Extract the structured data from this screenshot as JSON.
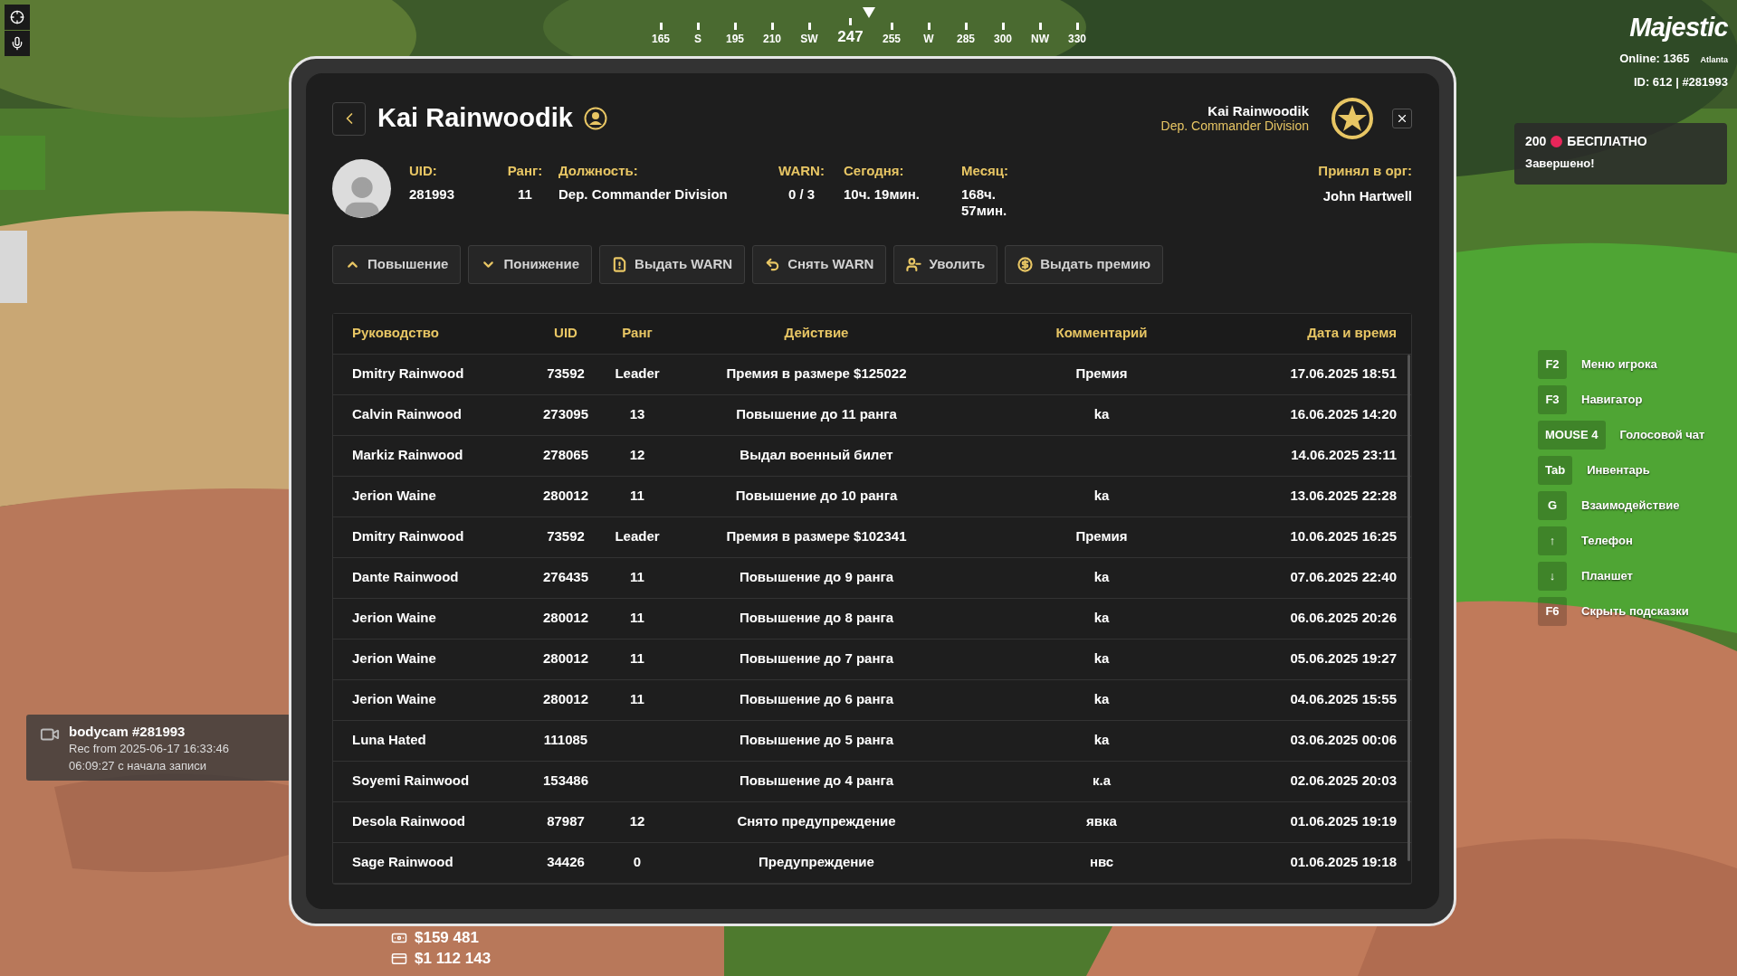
{
  "compass": {
    "heading": "247",
    "marks": [
      "165",
      "S",
      "195",
      "210",
      "SW",
      "255",
      "W",
      "285",
      "300",
      "NW",
      "330"
    ]
  },
  "hud": {
    "logo": "Majestic",
    "online": "Online: 1365",
    "server": "Atlanta",
    "id": "ID: 612 | #281993"
  },
  "promo": {
    "amount": "200",
    "label": "БЕСПЛАТНО",
    "status": "Завершено!"
  },
  "hints": [
    {
      "key": "F2",
      "label": "Меню игрока"
    },
    {
      "key": "F3",
      "label": "Навигатор"
    },
    {
      "key": "MOUSE 4",
      "label": "Голосовой чат"
    },
    {
      "key": "Tab",
      "label": "Инвентарь"
    },
    {
      "key": "G",
      "label": "Взаимодействие"
    },
    {
      "key": "↑",
      "label": "Телефон"
    },
    {
      "key": "↓",
      "label": "Планшет"
    },
    {
      "key": "F6",
      "label": "Скрыть подсказки"
    }
  ],
  "bodycam": {
    "title": "bodycam #281993",
    "rec": "Rec from 2025-06-17 16:33:46",
    "elapsed": "06:09:27 с начала записи"
  },
  "money": {
    "cash": "$159 481",
    "bank": "$1 112 143"
  },
  "profile": {
    "title": "Kai Rainwoodik",
    "viewer_name": "Kai Rainwoodik",
    "viewer_division": "Dep. Commander Division",
    "fields": [
      {
        "label": "UID:",
        "value": "281993"
      },
      {
        "label": "Ранг:",
        "value": "11"
      },
      {
        "label": "Должность:",
        "value": "Dep. Commander Division"
      },
      {
        "label": "WARN:",
        "value": "0 / 3"
      },
      {
        "label": "Сегодня:",
        "value": "10ч. 19мин."
      },
      {
        "label": "Месяц:",
        "value": "168ч. 57мин."
      }
    ],
    "accepted_by": {
      "label": "Принял в орг:",
      "value": "John Hartwell"
    },
    "actions": [
      "Повышение",
      "Понижение",
      "Выдать WARN",
      "Снять WARN",
      "Уволить",
      "Выдать премию"
    ]
  },
  "table": {
    "columns": [
      "Руководство",
      "UID",
      "Ранг",
      "Действие",
      "Комментарий",
      "Дата и время"
    ],
    "rows": [
      {
        "leader": "Dmitry Rainwood",
        "uid": "73592",
        "rank": "Leader",
        "action": "Премия в размере $125022",
        "comment": "Премия",
        "datetime": "17.06.2025 18:51"
      },
      {
        "leader": "Calvin Rainwood",
        "uid": "273095",
        "rank": "13",
        "action": "Повышение до 11 ранга",
        "comment": "ka",
        "datetime": "16.06.2025 14:20"
      },
      {
        "leader": "Markiz Rainwood",
        "uid": "278065",
        "rank": "12",
        "action": "Выдал военный билет",
        "datetime": "14.06.2025 23:11"
      },
      {
        "leader": "Jerion Waine",
        "uid": "280012",
        "rank": "11",
        "action": "Повышение до 10 ранга",
        "comment": "ka",
        "datetime": "13.06.2025 22:28"
      },
      {
        "leader": "Dmitry Rainwood",
        "uid": "73592",
        "rank": "Leader",
        "action": "Премия в размере $102341",
        "comment": "Премия",
        "datetime": "10.06.2025 16:25"
      },
      {
        "leader": "Dante Rainwood",
        "uid": "276435",
        "rank": "11",
        "action": "Повышение до 9 ранга",
        "comment": "ka",
        "datetime": "07.06.2025 22:40"
      },
      {
        "leader": "Jerion Waine",
        "uid": "280012",
        "rank": "11",
        "action": "Повышение до 8 ранга",
        "comment": "ka",
        "datetime": "06.06.2025 20:26"
      },
      {
        "leader": "Jerion Waine",
        "uid": "280012",
        "rank": "11",
        "action": "Повышение до 7 ранга",
        "comment": "ka",
        "datetime": "05.06.2025 19:27"
      },
      {
        "leader": "Jerion Waine",
        "uid": "280012",
        "rank": "11",
        "action": "Повышение до 6 ранга",
        "comment": "ka",
        "datetime": "04.06.2025 15:55"
      },
      {
        "leader": "Luna Hated",
        "uid": "111085",
        "action": "Повышение до 5 ранга",
        "comment": "ka",
        "datetime": "03.06.2025 00:06"
      },
      {
        "leader": "Soyemi Rainwood",
        "uid": "153486",
        "action": "Повышение до 4 ранга",
        "comment": "к.а",
        "datetime": "02.06.2025 20:03"
      },
      {
        "leader": "Desola Rainwood",
        "uid": "87987",
        "rank": "12",
        "action": "Снято предупреждение",
        "comment": "явка",
        "datetime": "01.06.2025 19:19"
      },
      {
        "leader": "Sage Rainwood",
        "uid": "34426",
        "rank": "0",
        "action": "Предупреждение",
        "comment": "нвс",
        "datetime": "01.06.2025 19:18"
      }
    ]
  }
}
